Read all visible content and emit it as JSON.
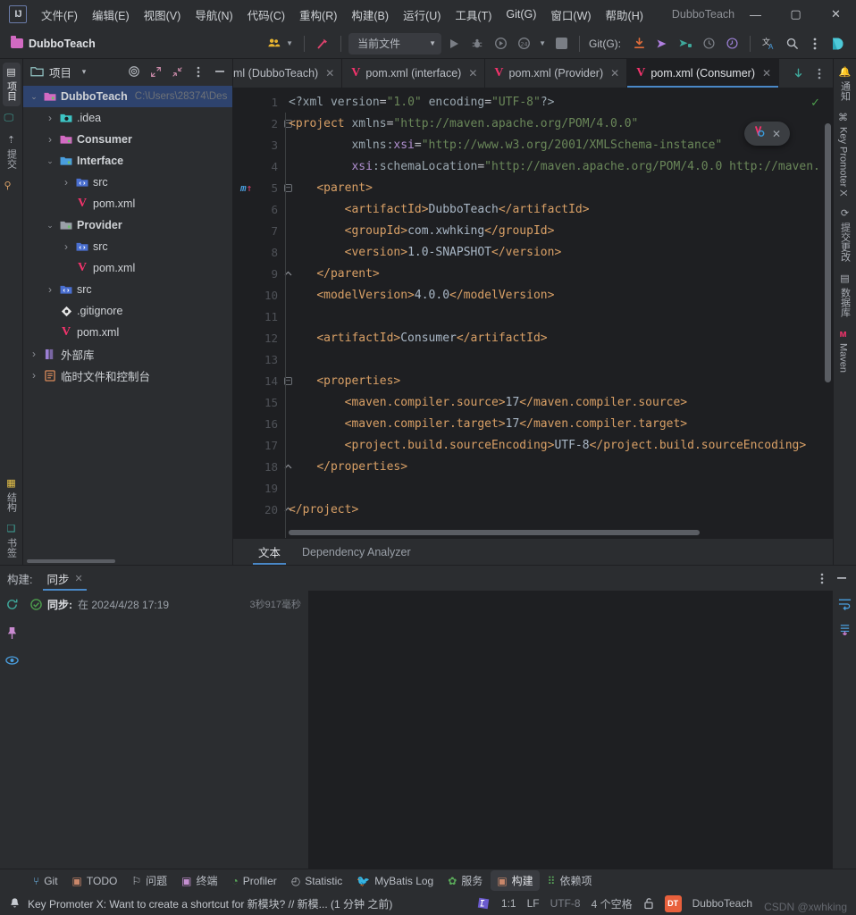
{
  "window": {
    "title": "DubboTeach",
    "menu": [
      "文件(F)",
      "编辑(E)",
      "视图(V)",
      "导航(N)",
      "代码(C)",
      "重构(R)",
      "构建(B)",
      "运行(U)",
      "工具(T)",
      "Git(G)",
      "窗口(W)",
      "帮助(H)"
    ],
    "controls": {
      "minimize": "—",
      "maximize": "▢",
      "close": "✕"
    },
    "logo": "IJ"
  },
  "toolbar": {
    "project_name": "DubboTeach",
    "run_config": "当前文件",
    "git_label": "Git(G):",
    "icons": {
      "avatar": "users-icon",
      "hammer": "build-icon",
      "run": "run-icon",
      "debug": "debug-icon",
      "run_with_coverage": "coverage-icon",
      "profiler": "profiler-icon",
      "stop": "stop-icon",
      "pull": "git-pull-icon",
      "push": "git-push-icon",
      "commit_push": "git-commit-push-icon",
      "history": "history-icon",
      "rollback": "rollback-icon",
      "translate": "translate-icon",
      "search": "search-icon",
      "more": "more-vertical-icon",
      "ai": "ai-assistant-icon"
    }
  },
  "left_strip": {
    "top": [
      {
        "label": "项目",
        "icon": "project-icon",
        "active": true
      },
      {
        "label": "",
        "icon": "monitor-icon",
        "active": false
      },
      {
        "label": "提交",
        "icon": "commit-icon",
        "active": false
      },
      {
        "label": "",
        "icon": "pull-request-icon",
        "active": false
      }
    ],
    "bottom": [
      {
        "label": "结构",
        "icon": "structure-icon"
      },
      {
        "label": "书签",
        "icon": "bookmarks-icon"
      }
    ]
  },
  "right_strip": {
    "items": [
      {
        "label": "通知",
        "icon": "bell-icon"
      },
      {
        "label": "Key Promoter X",
        "icon": "key-promoter-icon"
      },
      {
        "label": "提交更改",
        "icon": "commit-changes-icon"
      },
      {
        "label": "数据库",
        "icon": "database-icon"
      },
      {
        "label": "Maven",
        "icon": "maven-icon"
      }
    ]
  },
  "project_panel": {
    "title": "项目",
    "header_icons": [
      "chevron-down-icon",
      "target-icon",
      "expand-icon",
      "collapse-icon",
      "more-vertical-icon",
      "minimize-icon"
    ],
    "tree": [
      {
        "depth": 0,
        "arrow": "▾",
        "icon": "module-icon",
        "icon_color": "#d26ac2",
        "label": "DubboTeach",
        "bold": true,
        "path": "C:\\Users\\28374\\Des",
        "selected": true
      },
      {
        "depth": 1,
        "arrow": "›",
        "icon": "idea-folder-icon",
        "icon_color": "#3dc4c4",
        "label": ".idea",
        "bold": false,
        "path": "",
        "selected": false
      },
      {
        "depth": 1,
        "arrow": "›",
        "icon": "module-icon",
        "icon_color": "#d26ac2",
        "label": "Consumer",
        "bold": true,
        "path": "",
        "selected": false
      },
      {
        "depth": 1,
        "arrow": "▾",
        "icon": "ts-module-icon",
        "icon_color": "#4a9ede",
        "label": "Interface",
        "bold": true,
        "path": "",
        "selected": false
      },
      {
        "depth": 2,
        "arrow": "›",
        "icon": "source-root-icon",
        "icon_color": "#4a6fd0",
        "label": "src",
        "bold": false,
        "path": "",
        "selected": false
      },
      {
        "depth": 2,
        "arrow": "",
        "icon": "maven-file-icon",
        "icon_color": "#f4336c",
        "label": "pom.xml",
        "bold": false,
        "path": "",
        "selected": false
      },
      {
        "depth": 1,
        "arrow": "▾",
        "icon": "module-gray-icon",
        "icon_color": "#9aa0a8",
        "label": "Provider",
        "bold": true,
        "path": "",
        "selected": false
      },
      {
        "depth": 2,
        "arrow": "›",
        "icon": "source-root-icon",
        "icon_color": "#4a6fd0",
        "label": "src",
        "bold": false,
        "path": "",
        "selected": false
      },
      {
        "depth": 2,
        "arrow": "",
        "icon": "maven-file-icon",
        "icon_color": "#f4336c",
        "label": "pom.xml",
        "bold": false,
        "path": "",
        "selected": false
      },
      {
        "depth": 1,
        "arrow": "›",
        "icon": "source-root-icon",
        "icon_color": "#4a6fd0",
        "label": "src",
        "bold": false,
        "path": "",
        "selected": false
      },
      {
        "depth": 1,
        "arrow": "",
        "icon": "gitignore-icon",
        "icon_color": "#e8e8e8",
        "label": ".gitignore",
        "bold": false,
        "path": "",
        "selected": false
      },
      {
        "depth": 1,
        "arrow": "",
        "icon": "maven-file-icon",
        "icon_color": "#f4336c",
        "label": "pom.xml",
        "bold": false,
        "path": "",
        "selected": false
      },
      {
        "depth": 0,
        "arrow": "›",
        "icon": "library-icon",
        "icon_color": "#9b7fd4",
        "label": "外部库",
        "bold": false,
        "path": "",
        "selected": false
      },
      {
        "depth": 0,
        "arrow": "›",
        "icon": "scratches-icon",
        "icon_color": "#d88a5a",
        "label": "临时文件和控制台",
        "bold": false,
        "path": "",
        "selected": false
      }
    ]
  },
  "editor": {
    "tabs": [
      {
        "label": "ml (DubboTeach)",
        "icon": "maven-file-icon",
        "active": false,
        "truncated": true
      },
      {
        "label": "pom.xml (interface)",
        "icon": "maven-file-icon",
        "active": false,
        "truncated": false
      },
      {
        "label": "pom.xml (Provider)",
        "icon": "maven-file-icon",
        "active": false,
        "truncated": false
      },
      {
        "label": "pom.xml (Consumer)",
        "icon": "maven-file-icon",
        "active": true,
        "truncated": false
      }
    ],
    "tabbar_actions": [
      "scroll-down-icon",
      "more-vertical-icon"
    ],
    "floating_toolbar": {
      "reload_icon": "maven-reload-icon",
      "close": "✕"
    },
    "inspection_status": "✓",
    "bottom_tabs": [
      {
        "label": "文本",
        "active": true
      },
      {
        "label": "Dependency Analyzer",
        "active": false
      }
    ],
    "lines": [
      {
        "n": 1,
        "fold": "",
        "marker": "",
        "tokens": [
          {
            "t": "<?xml ",
            "c": "k-pi"
          },
          {
            "t": "version",
            "c": "k-attr"
          },
          {
            "t": "=",
            "c": "k-punct"
          },
          {
            "t": "\"1.0\"",
            "c": "k-val"
          },
          {
            "t": " ",
            "c": "k-punct"
          },
          {
            "t": "encoding",
            "c": "k-attr"
          },
          {
            "t": "=",
            "c": "k-punct"
          },
          {
            "t": "\"UTF-8\"",
            "c": "k-val"
          },
          {
            "t": "?>",
            "c": "k-pi"
          }
        ]
      },
      {
        "n": 2,
        "fold": "−",
        "marker": "",
        "tokens": [
          {
            "t": "<project",
            "c": "k-tag"
          },
          {
            "t": " ",
            "c": "k-punct"
          },
          {
            "t": "xmlns",
            "c": "k-attr"
          },
          {
            "t": "=",
            "c": "k-punct"
          },
          {
            "t": "\"http://maven.apache.org/POM/4.0.0\"",
            "c": "k-val"
          }
        ]
      },
      {
        "n": 3,
        "fold": "",
        "marker": "",
        "tokens": [
          {
            "t": "         xmlns:",
            "c": "k-attr"
          },
          {
            "t": "xsi",
            "c": "k-attr2"
          },
          {
            "t": "=",
            "c": "k-punct"
          },
          {
            "t": "\"http://www.w3.org/2001/XMLSchema-instance\"",
            "c": "k-val"
          }
        ]
      },
      {
        "n": 4,
        "fold": "",
        "marker": "",
        "tokens": [
          {
            "t": "         ",
            "c": "k-punct"
          },
          {
            "t": "xsi",
            "c": "k-attr2"
          },
          {
            "t": ":schemaLocation",
            "c": "k-attr"
          },
          {
            "t": "=",
            "c": "k-punct"
          },
          {
            "t": "\"http://maven.apache.org/POM/4.0.0 http://maven.",
            "c": "k-val"
          }
        ]
      },
      {
        "n": 5,
        "fold": "−",
        "marker": "m↑",
        "tokens": [
          {
            "t": "    ",
            "c": "k-punct"
          },
          {
            "t": "<parent>",
            "c": "k-tag"
          }
        ]
      },
      {
        "n": 6,
        "fold": "",
        "marker": "",
        "tokens": [
          {
            "t": "        ",
            "c": "k-punct"
          },
          {
            "t": "<artifactId>",
            "c": "k-tag"
          },
          {
            "t": "DubboTeach",
            "c": "k-text"
          },
          {
            "t": "</artifactId>",
            "c": "k-tag"
          }
        ]
      },
      {
        "n": 7,
        "fold": "",
        "marker": "",
        "tokens": [
          {
            "t": "        ",
            "c": "k-punct"
          },
          {
            "t": "<groupId>",
            "c": "k-tag"
          },
          {
            "t": "com.xwhking",
            "c": "k-text"
          },
          {
            "t": "</groupId>",
            "c": "k-tag"
          }
        ]
      },
      {
        "n": 8,
        "fold": "",
        "marker": "",
        "tokens": [
          {
            "t": "        ",
            "c": "k-punct"
          },
          {
            "t": "<version>",
            "c": "k-tag"
          },
          {
            "t": "1.0-SNAPSHOT",
            "c": "k-text"
          },
          {
            "t": "</version>",
            "c": "k-tag"
          }
        ]
      },
      {
        "n": 9,
        "fold": "⌃",
        "marker": "",
        "tokens": [
          {
            "t": "    ",
            "c": "k-punct"
          },
          {
            "t": "</parent>",
            "c": "k-tag"
          }
        ]
      },
      {
        "n": 10,
        "fold": "",
        "marker": "",
        "tokens": [
          {
            "t": "    ",
            "c": "k-punct"
          },
          {
            "t": "<modelVersion>",
            "c": "k-tag"
          },
          {
            "t": "4.0.0",
            "c": "k-text"
          },
          {
            "t": "</modelVersion>",
            "c": "k-tag"
          }
        ]
      },
      {
        "n": 11,
        "fold": "",
        "marker": "",
        "tokens": []
      },
      {
        "n": 12,
        "fold": "",
        "marker": "",
        "tokens": [
          {
            "t": "    ",
            "c": "k-punct"
          },
          {
            "t": "<artifactId>",
            "c": "k-tag"
          },
          {
            "t": "Consumer",
            "c": "k-text"
          },
          {
            "t": "</artifactId>",
            "c": "k-tag"
          }
        ]
      },
      {
        "n": 13,
        "fold": "",
        "marker": "",
        "tokens": []
      },
      {
        "n": 14,
        "fold": "−",
        "marker": "",
        "tokens": [
          {
            "t": "    ",
            "c": "k-punct"
          },
          {
            "t": "<properties>",
            "c": "k-tag"
          }
        ]
      },
      {
        "n": 15,
        "fold": "",
        "marker": "",
        "tokens": [
          {
            "t": "        ",
            "c": "k-punct"
          },
          {
            "t": "<maven.compiler.source>",
            "c": "k-tag"
          },
          {
            "t": "17",
            "c": "k-text"
          },
          {
            "t": "</maven.compiler.source>",
            "c": "k-tag"
          }
        ]
      },
      {
        "n": 16,
        "fold": "",
        "marker": "",
        "tokens": [
          {
            "t": "        ",
            "c": "k-punct"
          },
          {
            "t": "<maven.compiler.target>",
            "c": "k-tag"
          },
          {
            "t": "17",
            "c": "k-text"
          },
          {
            "t": "</maven.compiler.target>",
            "c": "k-tag"
          }
        ]
      },
      {
        "n": 17,
        "fold": "",
        "marker": "",
        "tokens": [
          {
            "t": "        ",
            "c": "k-punct"
          },
          {
            "t": "<project.build.sourceEncoding>",
            "c": "k-tag"
          },
          {
            "t": "UTF-8",
            "c": "k-text"
          },
          {
            "t": "</project.build.sourceEncoding>",
            "c": "k-tag"
          }
        ]
      },
      {
        "n": 18,
        "fold": "⌃",
        "marker": "",
        "tokens": [
          {
            "t": "    ",
            "c": "k-punct"
          },
          {
            "t": "</properties>",
            "c": "k-tag"
          }
        ]
      },
      {
        "n": 19,
        "fold": "",
        "marker": "",
        "tokens": []
      },
      {
        "n": 20,
        "fold": "⌃",
        "marker": "",
        "tokens": [
          {
            "t": "</project>",
            "c": "k-tag"
          }
        ]
      }
    ]
  },
  "build_panel": {
    "title": "构建:",
    "tab": "同步",
    "tab_close": "✕",
    "header_icons": [
      "more-vertical-icon",
      "minimize-icon"
    ],
    "left_icons": [
      "refresh-icon",
      "pin-icon",
      "eye-icon"
    ],
    "right_icons": [
      "soft-wrap-icon",
      "scroll-to-end-icon"
    ],
    "sync": {
      "status_icon": "success-check-icon",
      "label": "同步:",
      "value": "在 2024/4/28 17:19",
      "duration": "3秒917毫秒"
    }
  },
  "tool_windows": [
    {
      "label": "Git",
      "icon": "git-branch-icon",
      "color": "#6cb6e8",
      "active": false
    },
    {
      "label": "TODO",
      "icon": "todo-icon",
      "color": "#c9876a",
      "active": false
    },
    {
      "label": "问题",
      "icon": "problems-icon",
      "color": "#b8bcc2",
      "active": false
    },
    {
      "label": "终端",
      "icon": "terminal-icon",
      "color": "#c48fd0",
      "active": false
    },
    {
      "label": "Profiler",
      "icon": "profiler-icon",
      "color": "#5aab5a",
      "active": false
    },
    {
      "label": "Statistic",
      "icon": "statistic-icon",
      "color": "#b8bcc2",
      "active": false
    },
    {
      "label": "MyBatis Log",
      "icon": "mybatis-icon",
      "color": "#d04a2a",
      "active": false
    },
    {
      "label": "服务",
      "icon": "services-icon",
      "color": "#5aab5a",
      "active": false
    },
    {
      "label": "构建",
      "icon": "build-icon",
      "color": "#c9876a",
      "active": true
    },
    {
      "label": "依赖项",
      "icon": "dependencies-icon",
      "color": "#5aab5a",
      "active": false
    }
  ],
  "status_bar": {
    "notification_icon": "notification-icon",
    "message": "Key Promoter X: Want to create a shortcut for 新模块? // 新模... (1 分钟 之前)",
    "ide_icon": "idea-badge-icon",
    "caret": "1:1",
    "line_sep": "LF",
    "encoding": "UTF-8",
    "indent": "4 个空格",
    "lock_icon": "unlocked-icon",
    "branch_badge": "DT",
    "branch": "DubboTeach",
    "watermark": "CSDN @xwhking"
  }
}
